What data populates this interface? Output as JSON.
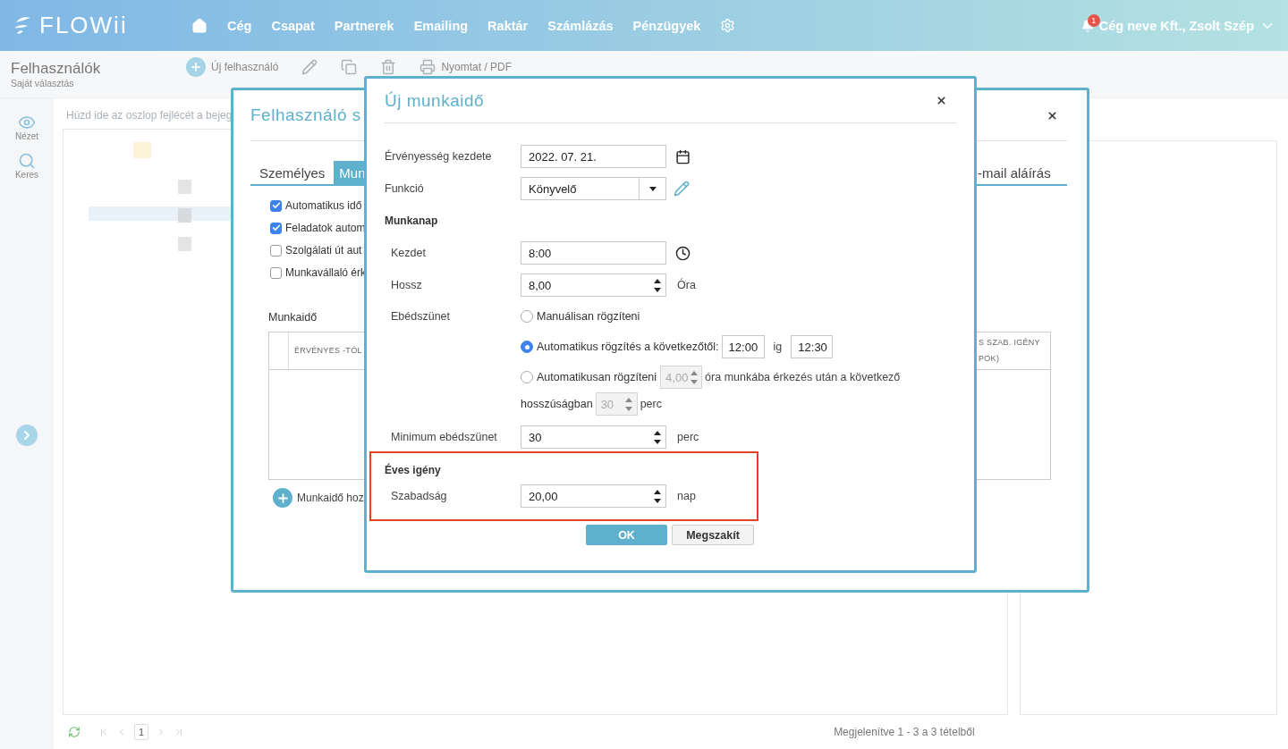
{
  "app": {
    "logo": "FLOWii",
    "nav": [
      {
        "label": "Cég"
      },
      {
        "label": "Csapat"
      },
      {
        "label": "Partnerek"
      },
      {
        "label": "Emailing"
      },
      {
        "label": "Raktár"
      },
      {
        "label": "Számlázás"
      },
      {
        "label": "Pénzügyek"
      }
    ],
    "notification_count": "1",
    "user": "Cég neve Kft., Zsolt Szép"
  },
  "page": {
    "title": "Felhasználók",
    "subtitle": "Saját választás",
    "toolbar": [
      {
        "kind": "add",
        "label": "Új felhasználó"
      },
      {
        "kind": "edit"
      },
      {
        "kind": "copy"
      },
      {
        "kind": "delete"
      },
      {
        "kind": "print",
        "label": "Nyomtat / PDF"
      }
    ]
  },
  "side_rail": [
    {
      "kind": "view",
      "label": "Nézet"
    },
    {
      "kind": "search",
      "label": "Keres"
    }
  ],
  "group_panel": {
    "placeholder": "Húzd ide az oszlop fejlécét a bejeg"
  },
  "pager": {
    "page": "1",
    "summary": "Megjelenítve 1 - 3 a 3 tételből"
  },
  "user_dialog": {
    "title": "Felhasználó s",
    "tabs": [
      {
        "label": "Személyes",
        "selected": false
      },
      {
        "label": "Mun",
        "selected": true
      },
      {
        "label": "-mail aláírás",
        "selected": false
      }
    ],
    "options": [
      {
        "label": "Automatikus idő",
        "checked": true
      },
      {
        "label": "Feladatok autom",
        "checked": true
      },
      {
        "label": "Szolgálati út aut",
        "checked": false
      },
      {
        "label": "Munkavállaló érk",
        "checked": false
      }
    ],
    "section": "Munkaidő",
    "columns": [
      "ÉRVÉNYES -TÓL",
      "S SZAB. IGÉNY POK)"
    ],
    "add_label": "Munkaidő hoz"
  },
  "work_dialog": {
    "title": "Új munkaidő",
    "rows": [
      {
        "kind": "date",
        "label": "Érvényesség kezdete",
        "value": "2022. 07. 21."
      },
      {
        "kind": "select",
        "label": "Funkció",
        "value": "Könyvelő"
      },
      {
        "kind": "group",
        "label": "Munkanap",
        "children": [
          {
            "kind": "time",
            "label": "Kezdet",
            "value": "8:00"
          },
          {
            "kind": "number",
            "label": "Hossz",
            "value": "8,00",
            "unit": "Óra"
          },
          {
            "kind": "radios",
            "label": "Ebédszünet",
            "options": [
              {
                "kind": "plain",
                "label": "Manuálisan rögzíteni",
                "selected": false
              },
              {
                "kind": "range",
                "label": "Automatikus rögzítés a következőtől:",
                "from": "12:00",
                "between": "ig",
                "to": "12:30",
                "selected": true
              },
              {
                "kind": "after",
                "label": "Automatikusan rögzíteni",
                "hours": "4,00",
                "text": "óra munkába érkezés után a következő",
                "text2": "hosszúságban",
                "minutes": "30",
                "unit": "perc",
                "selected": false
              }
            ]
          },
          {
            "kind": "number",
            "label": "Minimum ebédszünet",
            "value": "30",
            "unit": "perc"
          }
        ]
      }
    ],
    "annual": {
      "title": "Éves igény",
      "highlighted": true,
      "children": [
        {
          "kind": "number",
          "label": "Szabadság",
          "value": "20,00",
          "unit": "nap"
        }
      ]
    },
    "buttons": [
      {
        "kind": "primary",
        "label": "OK"
      },
      {
        "kind": "secondary",
        "label": "Megszakít"
      }
    ]
  }
}
